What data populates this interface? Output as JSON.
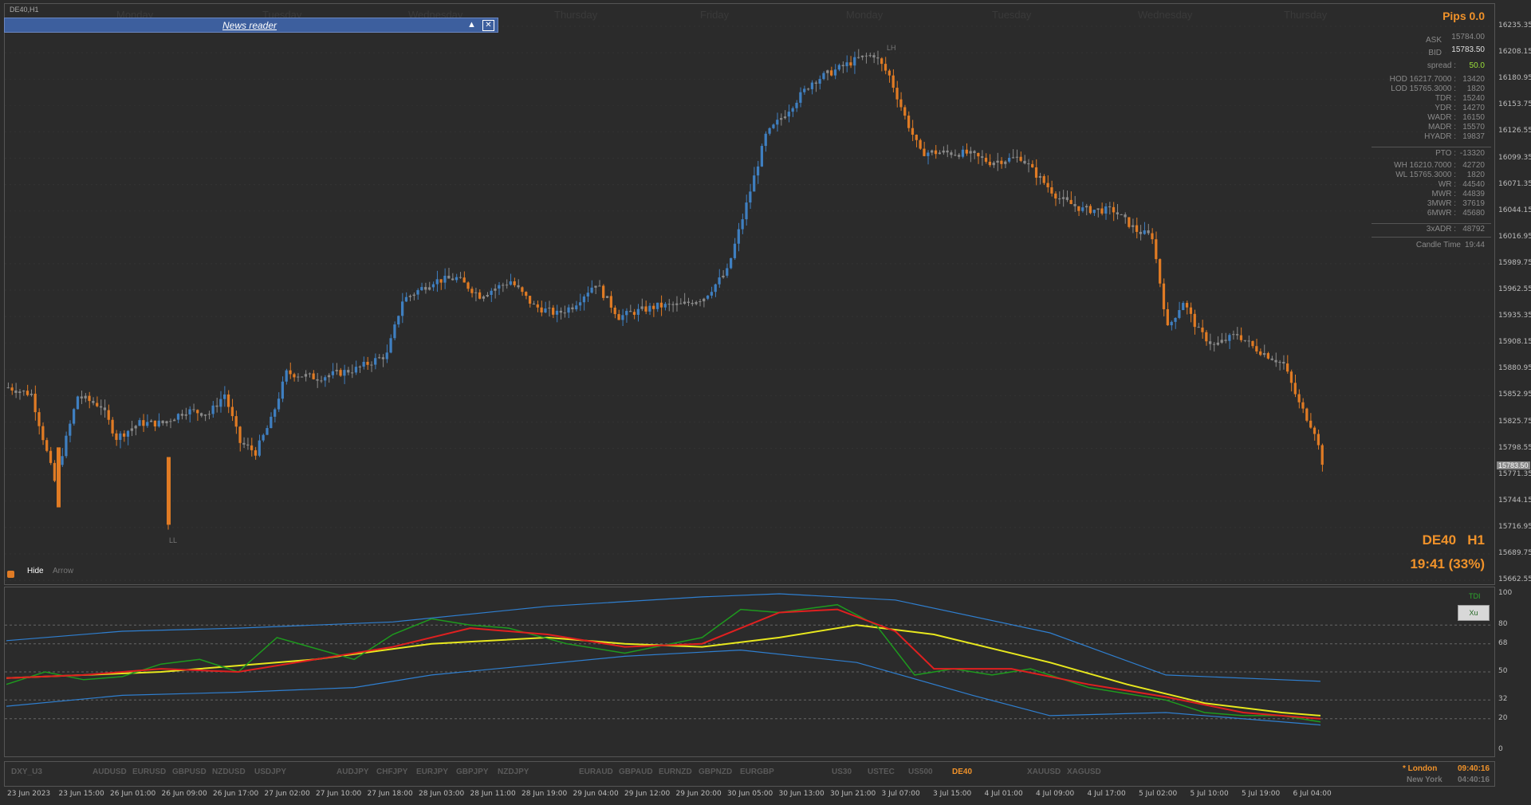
{
  "window": {
    "title": "DE40,H1"
  },
  "news_reader": {
    "label": "News reader",
    "collapse_icon": "▲",
    "close_icon": "✕"
  },
  "day_labels": [
    "Monday",
    "Tuesday",
    "Wednesday",
    "Thursday",
    "Friday",
    "Monday",
    "Tuesday",
    "Wednesday",
    "Thursday"
  ],
  "price_axis": {
    "ticks": [
      "16235.35",
      "16208.15",
      "16180.95",
      "16153.75",
      "16126.55",
      "16099.35",
      "16071.35",
      "16044.15",
      "16016.95",
      "15989.75",
      "15962.55",
      "15935.35",
      "15908.15",
      "15880.95",
      "15852.95",
      "15825.75",
      "15798.55",
      "15771.35",
      "15744.15",
      "15716.95",
      "15689.75",
      "15662.55"
    ],
    "current_price": "15783.50",
    "min": 15662.55,
    "max": 16235.35
  },
  "info": {
    "pips": "Pips 0.0",
    "ask_label": "ASK",
    "ask_value": "15784.00",
    "bid_label": "BID",
    "bid_value": "15783.50",
    "spread_label": "spread :",
    "spread_value": "50.0",
    "rows1": [
      {
        "label": "HOD 16217.7000 :",
        "value": "13420"
      },
      {
        "label": "LOD 15765.3000 :",
        "value": "1820"
      },
      {
        "label": "TDR :",
        "value": "15240"
      },
      {
        "label": "YDR :",
        "value": "14270"
      },
      {
        "label": "WADR :",
        "value": "16150"
      },
      {
        "label": "MADR :",
        "value": "15570"
      },
      {
        "label": "HYADR :",
        "value": "19837"
      }
    ],
    "pto": {
      "label": "PTO :",
      "value": "-13320"
    },
    "rows2": [
      {
        "label": "WH 16210.7000 :",
        "value": "42720"
      },
      {
        "label": "WL 15765.3000 :",
        "value": "1820"
      },
      {
        "label": "WR :",
        "value": "44540"
      },
      {
        "label": "MWR :",
        "value": "44839"
      },
      {
        "label": "3MWR :",
        "value": "37619"
      },
      {
        "label": "6MWR :",
        "value": "45680"
      }
    ],
    "xadr": {
      "label": "3xADR :",
      "value": "48792"
    },
    "candle_time": {
      "label": "Candle Time",
      "value": "19:44"
    },
    "symbol": "DE40",
    "timeframe": "H1",
    "countdown": "19:41 (33%)"
  },
  "markers": {
    "lh": "LH",
    "ll": "LL"
  },
  "controls": {
    "hide": "Hide",
    "arrow": "Arrow"
  },
  "indicator": {
    "name": "TDI",
    "button": "Xu",
    "levels": [
      "100",
      "80",
      "68",
      "50",
      "32",
      "20",
      "0"
    ],
    "colors": {
      "upper": "#2f7fd0",
      "rsi": "#1e9a1e",
      "signal": "#e02020",
      "market": "#e8e81e"
    }
  },
  "symbols": [
    "DXY_U3",
    "AUDUSD",
    "EURUSD",
    "GBPUSD",
    "NZDUSD",
    "USDJPY",
    "AUDJPY",
    "CHFJPY",
    "EURJPY",
    "GBPJPY",
    "NZDJPY",
    "EURAUD",
    "GBPAUD",
    "EURNZD",
    "GBPNZD",
    "EURGBP",
    "US30",
    "USTEC",
    "US500",
    "DE40",
    "XAUUSD",
    "XAGUSD"
  ],
  "active_symbol": "DE40",
  "sessions": [
    {
      "label": "* London",
      "time": "09:40:16",
      "active": true
    },
    {
      "label": "New York",
      "time": "04:40:16",
      "active": false
    }
  ],
  "time_axis": [
    "23 Jun 2023",
    "23 Jun 15:00",
    "26 Jun 01:00",
    "26 Jun 09:00",
    "26 Jun 17:00",
    "27 Jun 02:00",
    "27 Jun 10:00",
    "27 Jun 18:00",
    "28 Jun 03:00",
    "28 Jun 11:00",
    "28 Jun 19:00",
    "29 Jun 04:00",
    "29 Jun 12:00",
    "29 Jun 20:00",
    "30 Jun 05:00",
    "30 Jun 13:00",
    "30 Jun 21:00",
    "3 Jul 07:00",
    "3 Jul 15:00",
    "4 Jul 01:00",
    "4 Jul 09:00",
    "4 Jul 17:00",
    "5 Jul 02:00",
    "5 Jul 10:00",
    "5 Jul 19:00",
    "6 Jul 04:00"
  ],
  "chart_data": {
    "type": "candlestick",
    "symbol": "DE40",
    "timeframe": "H1",
    "waypoints": [
      [
        0,
        15862
      ],
      [
        6,
        15855
      ],
      [
        12,
        15765
      ],
      [
        18,
        15853
      ],
      [
        24,
        15843
      ],
      [
        28,
        15810
      ],
      [
        34,
        15825
      ],
      [
        40,
        15825
      ],
      [
        46,
        15838
      ],
      [
        52,
        15835
      ],
      [
        56,
        15855
      ],
      [
        60,
        15805
      ],
      [
        64,
        15795
      ],
      [
        68,
        15828
      ],
      [
        72,
        15877
      ],
      [
        80,
        15872
      ],
      [
        90,
        15881
      ],
      [
        98,
        15896
      ],
      [
        102,
        15952
      ],
      [
        110,
        15972
      ],
      [
        116,
        15975
      ],
      [
        122,
        15957
      ],
      [
        130,
        15972
      ],
      [
        136,
        15946
      ],
      [
        142,
        15938
      ],
      [
        146,
        15946
      ],
      [
        152,
        15970
      ],
      [
        158,
        15935
      ],
      [
        162,
        15940
      ],
      [
        168,
        15946
      ],
      [
        174,
        15947
      ],
      [
        180,
        15955
      ],
      [
        186,
        15982
      ],
      [
        190,
        16037
      ],
      [
        196,
        16122
      ],
      [
        202,
        16150
      ],
      [
        208,
        16178
      ],
      [
        214,
        16190
      ],
      [
        220,
        16202
      ],
      [
        224,
        16206
      ],
      [
        228,
        16184
      ],
      [
        232,
        16142
      ],
      [
        236,
        16105
      ],
      [
        240,
        16105
      ],
      [
        248,
        16104
      ],
      [
        254,
        16095
      ],
      [
        262,
        16100
      ],
      [
        266,
        16082
      ],
      [
        272,
        16057
      ],
      [
        278,
        16046
      ],
      [
        286,
        16045
      ],
      [
        292,
        16024
      ],
      [
        296,
        16018
      ],
      [
        300,
        15923
      ],
      [
        304,
        15951
      ],
      [
        308,
        15920
      ],
      [
        312,
        15905
      ],
      [
        318,
        15917
      ],
      [
        322,
        15904
      ],
      [
        326,
        15895
      ],
      [
        330,
        15886
      ],
      [
        334,
        15845
      ],
      [
        338,
        15817
      ],
      [
        340,
        15785
      ]
    ],
    "tdi_upper_band": [
      [
        0,
        70
      ],
      [
        30,
        76
      ],
      [
        60,
        78
      ],
      [
        100,
        82
      ],
      [
        140,
        92
      ],
      [
        180,
        98
      ],
      [
        200,
        100
      ],
      [
        230,
        96
      ],
      [
        270,
        75
      ],
      [
        300,
        48
      ],
      [
        330,
        45
      ],
      [
        340,
        44
      ]
    ],
    "tdi_lower_band": [
      [
        0,
        28
      ],
      [
        30,
        35
      ],
      [
        60,
        37
      ],
      [
        90,
        40
      ],
      [
        110,
        48
      ],
      [
        160,
        60
      ],
      [
        190,
        64
      ],
      [
        220,
        56
      ],
      [
        250,
        35
      ],
      [
        270,
        22
      ],
      [
        300,
        24
      ],
      [
        340,
        16
      ]
    ],
    "tdi_rsi": [
      [
        0,
        42
      ],
      [
        10,
        50
      ],
      [
        20,
        45
      ],
      [
        30,
        47
      ],
      [
        40,
        55
      ],
      [
        50,
        58
      ],
      [
        60,
        50
      ],
      [
        70,
        72
      ],
      [
        80,
        65
      ],
      [
        90,
        58
      ],
      [
        100,
        74
      ],
      [
        110,
        84
      ],
      [
        120,
        80
      ],
      [
        130,
        78
      ],
      [
        145,
        68
      ],
      [
        160,
        62
      ],
      [
        180,
        72
      ],
      [
        190,
        90
      ],
      [
        200,
        88
      ],
      [
        215,
        93
      ],
      [
        225,
        80
      ],
      [
        235,
        48
      ],
      [
        245,
        52
      ],
      [
        255,
        48
      ],
      [
        265,
        52
      ],
      [
        280,
        40
      ],
      [
        290,
        36
      ],
      [
        300,
        32
      ],
      [
        310,
        24
      ],
      [
        320,
        22
      ],
      [
        330,
        22
      ],
      [
        340,
        18
      ]
    ],
    "tdi_signal": [
      [
        0,
        46
      ],
      [
        20,
        48
      ],
      [
        40,
        52
      ],
      [
        60,
        50
      ],
      [
        80,
        58
      ],
      [
        100,
        66
      ],
      [
        120,
        78
      ],
      [
        140,
        74
      ],
      [
        160,
        66
      ],
      [
        180,
        68
      ],
      [
        200,
        88
      ],
      [
        215,
        90
      ],
      [
        230,
        76
      ],
      [
        240,
        52
      ],
      [
        260,
        52
      ],
      [
        280,
        42
      ],
      [
        300,
        34
      ],
      [
        320,
        24
      ],
      [
        340,
        20
      ]
    ],
    "tdi_market_base": [
      [
        0,
        46
      ],
      [
        40,
        50
      ],
      [
        80,
        58
      ],
      [
        110,
        68
      ],
      [
        140,
        72
      ],
      [
        160,
        68
      ],
      [
        180,
        66
      ],
      [
        200,
        72
      ],
      [
        220,
        80
      ],
      [
        240,
        74
      ],
      [
        270,
        56
      ],
      [
        290,
        42
      ],
      [
        310,
        30
      ],
      [
        330,
        24
      ],
      [
        340,
        22
      ]
    ]
  }
}
